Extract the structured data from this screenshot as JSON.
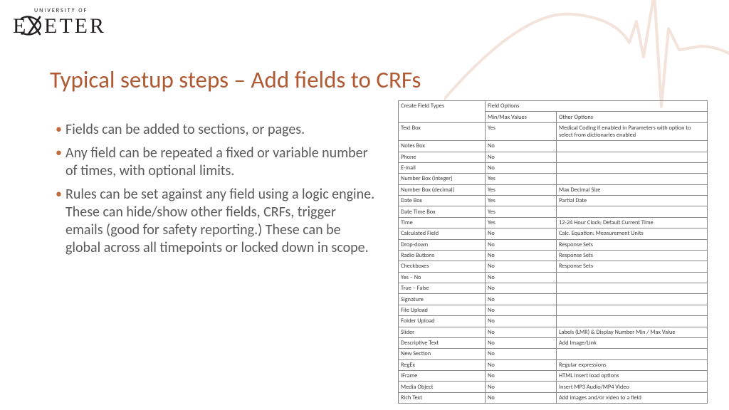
{
  "logo": {
    "tagline": "UNIVERSITY OF",
    "word": "EXETER"
  },
  "title": "Typical setup steps – Add fields to CRFs",
  "bullets": [
    "Fields can be added to sections, or pages.",
    "Any field can be repeated a fixed or variable number of times, with optional limits.",
    "Rules can be set against any field using a logic engine. These can hide/show other fields, CRFs, trigger emails (good for safety reporting.) These can be global across all timepoints or locked down in scope."
  ],
  "table": {
    "header1": {
      "c1": "Create Field Types",
      "c2": "Field Options"
    },
    "header2": {
      "c2": "Min/Max Values",
      "c3": "Other Options"
    },
    "rows": [
      {
        "c1": "Text Box",
        "c2": "Yes",
        "c3": "Medical Coding if enabled in Parameters with option to select from dictionaries enabled"
      },
      {
        "c1": "Notes Box",
        "c2": "No",
        "c3": ""
      },
      {
        "c1": "Phone",
        "c2": "No",
        "c3": ""
      },
      {
        "c1": "E-mail",
        "c2": "No",
        "c3": ""
      },
      {
        "c1": "Number Box (integer)",
        "c2": "Yes",
        "c3": ""
      },
      {
        "c1": "Number Box (decimal)",
        "c2": "Yes",
        "c3": "Max Decimal Size"
      },
      {
        "c1": "Date Box",
        "c2": "Yes",
        "c3": "Partial Date"
      },
      {
        "c1": "Date Time Box",
        "c2": "Yes",
        "c3": ""
      },
      {
        "c1": "Time",
        "c2": "Yes",
        "c3": "12-24 Hour Clock; Default Current Time"
      },
      {
        "c1": "Calculated Field",
        "c2": "No",
        "c3": "Calc. Equation: Measurement Units"
      },
      {
        "c1": "Drop-down",
        "c2": "No",
        "c3": "Response Sets"
      },
      {
        "c1": "Radio Buttons",
        "c2": "No",
        "c3": "Response Sets"
      },
      {
        "c1": "Checkboxes",
        "c2": "No",
        "c3": "Response Sets"
      },
      {
        "c1": "Yes – No",
        "c2": "No",
        "c3": ""
      },
      {
        "c1": "True – False",
        "c2": "No",
        "c3": ""
      },
      {
        "c1": "Signature",
        "c2": "No",
        "c3": ""
      },
      {
        "c1": "File Upload",
        "c2": "No",
        "c3": ""
      },
      {
        "c1": "Folder Upload",
        "c2": "No",
        "c3": ""
      },
      {
        "c1": "Slider",
        "c2": "No",
        "c3": "Labels (LMR) & Display Number Min / Max Value"
      },
      {
        "c1": "Descriptive Text",
        "c2": "No",
        "c3": "Add Image/Link"
      },
      {
        "c1": "New Section",
        "c2": "No",
        "c3": ""
      },
      {
        "c1": "RegEx",
        "c2": "No",
        "c3": "Regular expressions"
      },
      {
        "c1": "IFrame",
        "c2": "No",
        "c3": "HTML insert load options"
      },
      {
        "c1": "Media Object",
        "c2": "No",
        "c3": "Insert MP3 Audio/MP4 Video"
      },
      {
        "c1": "Rich Text",
        "c2": "No",
        "c3": "Add images and/or video to a field"
      }
    ]
  }
}
